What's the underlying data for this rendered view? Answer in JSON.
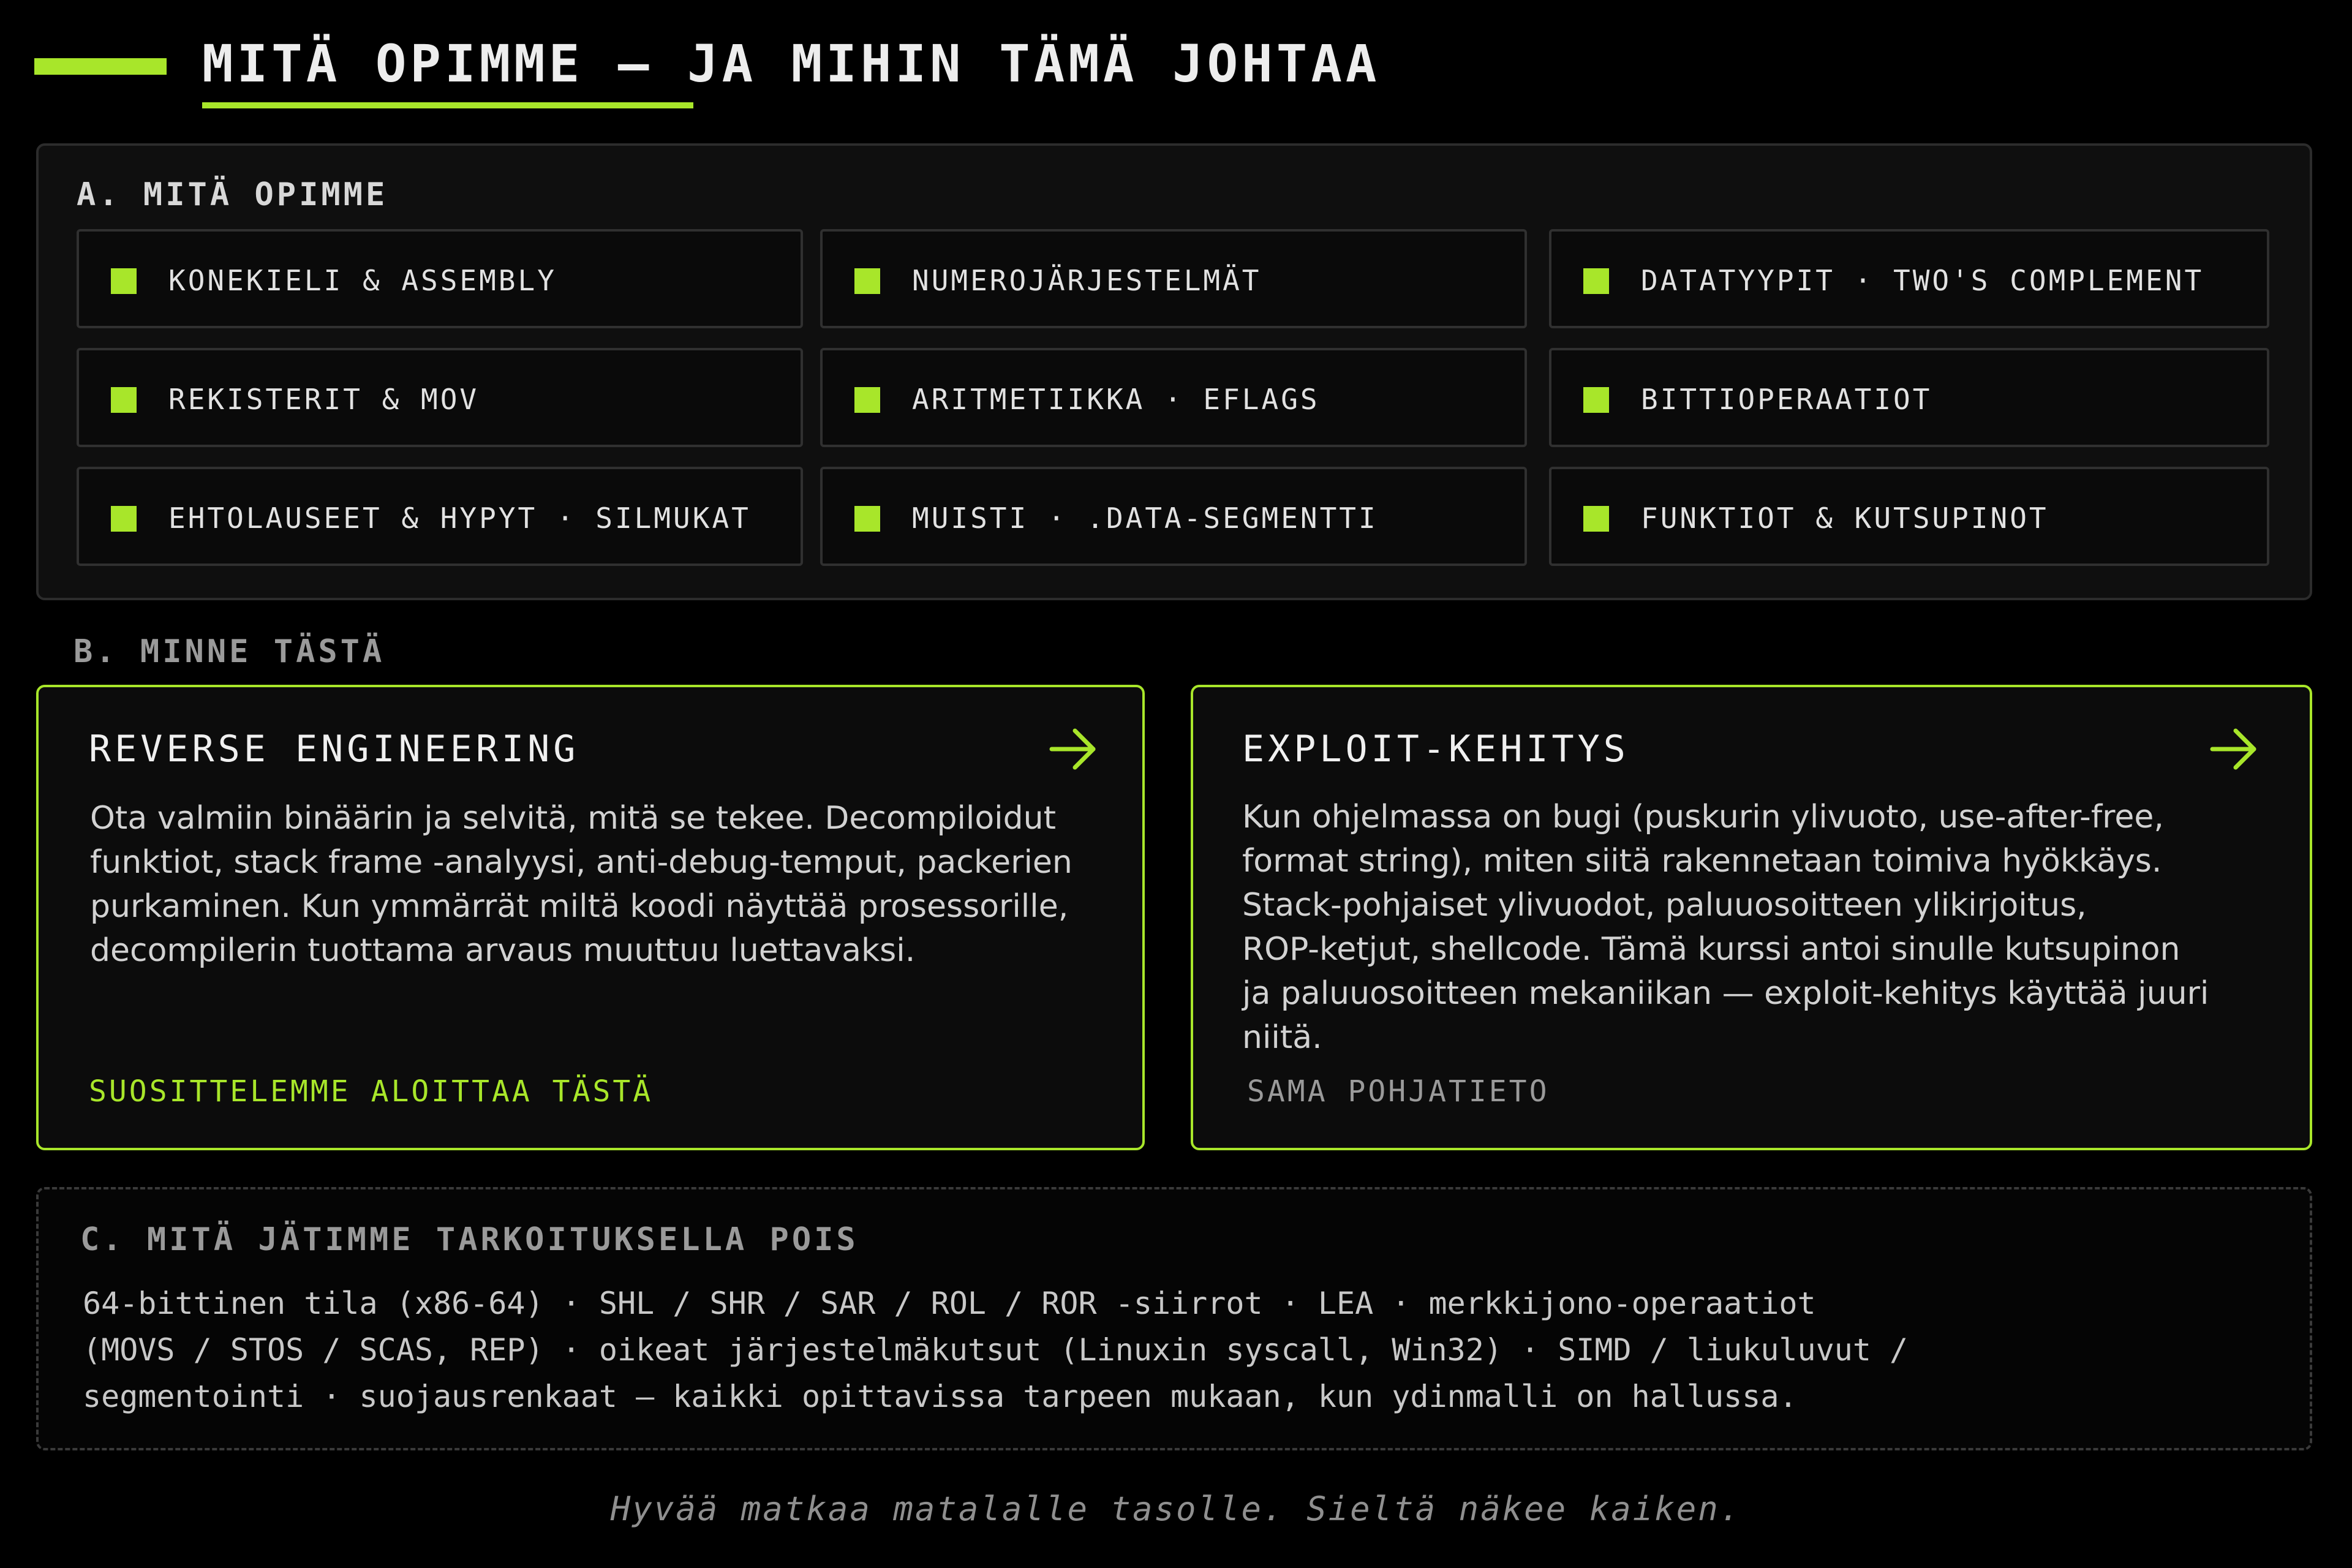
{
  "colors": {
    "accent": "#a8e62a",
    "background": "#000000",
    "panel": "#0f0f0f",
    "panel_border": "#2c2c2c",
    "text": "#e6e6e6",
    "muted": "#9a9a9a"
  },
  "header": {
    "title": "MITÄ OPIMME — JA MIHIN TÄMÄ JOHTAA"
  },
  "section_a": {
    "label": "A. MITÄ OPIMME",
    "topics": [
      {
        "label": "KONEKIELI & ASSEMBLY",
        "icon": "square-bullet-icon"
      },
      {
        "label": "NUMEROJÄRJESTELMÄT",
        "icon": "square-bullet-icon"
      },
      {
        "label": "DATATYYPIT · TWO'S COMPLEMENT",
        "icon": "square-bullet-icon"
      },
      {
        "label": "REKISTERIT & MOV",
        "icon": "square-bullet-icon"
      },
      {
        "label": "ARITMETIIKKA · EFLAGS",
        "icon": "square-bullet-icon"
      },
      {
        "label": "BITTIOPERAATIOT",
        "icon": "square-bullet-icon"
      },
      {
        "label": "EHTOLAUSEET & HYPYT · SILMUKAT",
        "icon": "square-bullet-icon"
      },
      {
        "label": "MUISTI · .DATA-SEGMENTTI",
        "icon": "square-bullet-icon"
      },
      {
        "label": "FUNKTIOT & KUTSUPINOT",
        "icon": "square-bullet-icon"
      }
    ]
  },
  "section_b": {
    "label": "B. MINNE TÄSTÄ",
    "cards": [
      {
        "title": "REVERSE ENGINEERING",
        "icon": "arrow-right-icon",
        "body_lines": [
          "Ota valmiin binäärin ja selvitä, mitä se tekee. Decompiloidut",
          "funktiot, stack frame -analyysi, anti-debug-temput, packerien",
          "purkaminen. Kun ymmärrät miltä koodi näyttää prosessorille,",
          "decompilerin tuottama arvaus muuttuu luettavaksi."
        ],
        "footer": "SUOSITTELEMME ALOITTAA TÄSTÄ"
      },
      {
        "title": "EXPLOIT-KEHITYS",
        "icon": "arrow-right-icon",
        "body_lines": [
          "Kun ohjelmassa on bugi (puskurin ylivuoto, use-after-free,",
          "format string), miten siitä rakennetaan toimiva hyökkäys.",
          "Stack-pohjaiset ylivuodot, paluuosoitteen ylikirjoitus,",
          "ROP-ketjut, shellcode. Tämä kurssi antoi sinulle kutsupinon",
          "ja paluuosoitteen mekaniikan — exploit-kehitys käyttää juuri",
          "niitä."
        ],
        "footer": "SAMA POHJATIETO"
      }
    ]
  },
  "section_c": {
    "label": "C. MITÄ JÄTIMME TARKOITUKSELLA POIS",
    "body_lines": [
      "64-bittinen tila (x86-64) · SHL / SHR / SAR / ROL / ROR -siirrot · LEA · merkkijono-operaatiot",
      "(MOVS / STOS / SCAS, REP) · oikeat järjestelmäkutsut (Linuxin syscall, Win32) · SIMD / liukuluvut /",
      "segmentointi · suojausrenkaat — kaikki opittavissa tarpeen mukaan, kun ydinmalli on hallussa."
    ]
  },
  "footer": {
    "note": "Hyvää matkaa matalalle tasolle. Sieltä näkee kaiken."
  }
}
